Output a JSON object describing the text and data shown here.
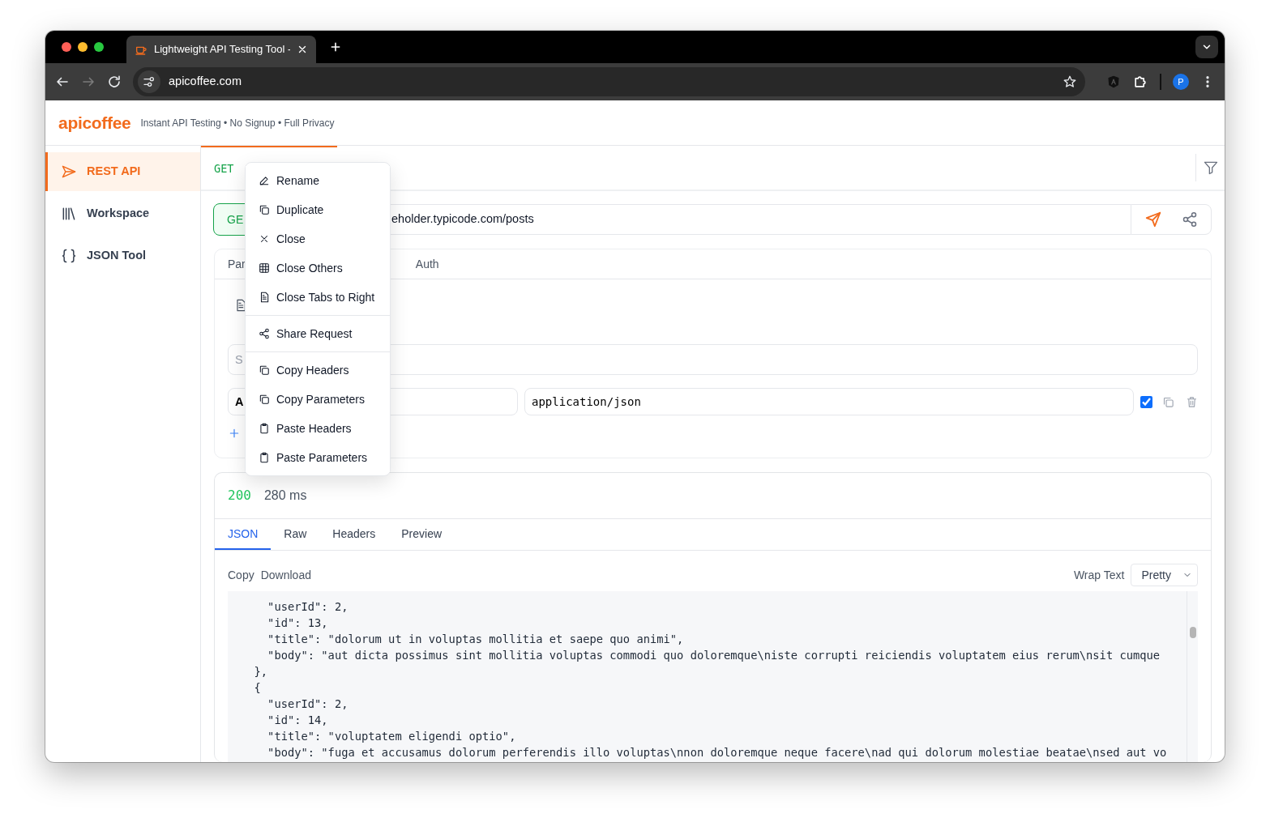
{
  "browser": {
    "tab_title": "Lightweight API Testing Tool -",
    "url": "apicoffee.com",
    "profile_initial": "P",
    "forward_disabled": true
  },
  "app": {
    "logo": "apicoffee",
    "tagline": "Instant API Testing • No Signup • Full Privacy"
  },
  "sidebar": {
    "items": [
      {
        "label": "REST API",
        "selected": true
      },
      {
        "label": "Workspace",
        "selected": false
      },
      {
        "label": "JSON Tool",
        "selected": false
      }
    ]
  },
  "request_tabs": [
    {
      "method": "GET",
      "selected": true
    }
  ],
  "request": {
    "method": "GE",
    "url": "eholder.typicode.com/posts"
  },
  "section_tabs": [
    {
      "label": "Par",
      "selected": false
    },
    {
      "label": "Auth",
      "selected": false
    }
  ],
  "headers": {
    "search_placeholder": "S",
    "rows": [
      {
        "key": "A",
        "value": "application/json",
        "enabled": true
      }
    ]
  },
  "context_menu": {
    "groups": [
      [
        "Rename",
        "Duplicate",
        "Close",
        "Close Others",
        "Close Tabs to Right"
      ],
      [
        "Share Request"
      ],
      [
        "Copy Headers",
        "Copy Parameters",
        "Paste Headers",
        "Paste Parameters"
      ]
    ]
  },
  "response": {
    "status": "200",
    "time": "280 ms",
    "tabs": [
      {
        "label": "JSON",
        "selected": true
      },
      {
        "label": "Raw",
        "selected": false
      },
      {
        "label": "Headers",
        "selected": false
      },
      {
        "label": "Preview",
        "selected": false
      }
    ],
    "actions": [
      "Copy",
      "Download"
    ],
    "wrap_label": "Wrap Text",
    "format": "Pretty",
    "lines": [
      "    \"userId\": 2,",
      "    \"id\": 13,",
      "    \"title\": \"dolorum ut in voluptas mollitia et saepe quo animi\",",
      "    \"body\": \"aut dicta possimus sint mollitia voluptas commodi quo doloremque\\niste corrupti reiciendis voluptatem eius rerum\\nsit cumque",
      "  },",
      "  {",
      "    \"userId\": 2,",
      "    \"id\": 14,",
      "    \"title\": \"voluptatem eligendi optio\",",
      "    \"body\": \"fuga et accusamus dolorum perferendis illo voluptas\\nnon doloremque neque facere\\nad qui dolorum molestiae beatae\\nsed aut vo"
    ]
  }
}
